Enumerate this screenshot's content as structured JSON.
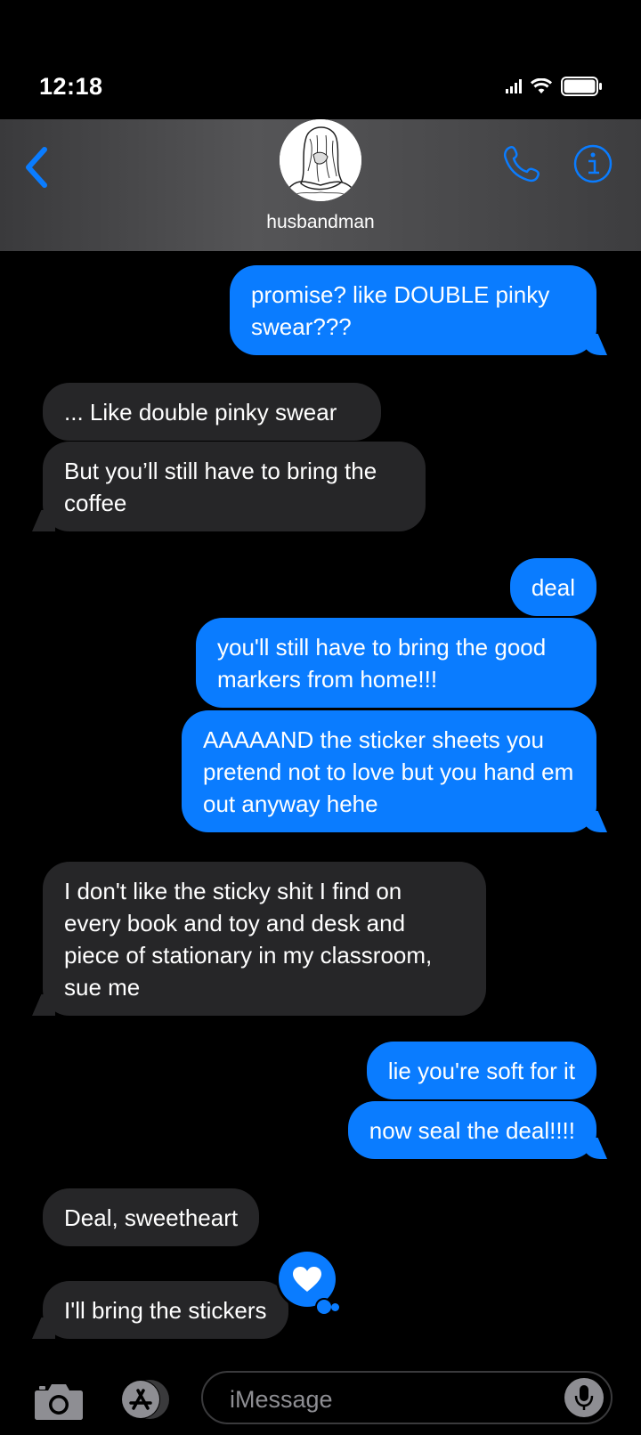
{
  "status_bar": {
    "time": "12:18"
  },
  "header": {
    "contact_name": "husbandman",
    "icons": [
      "chevron-left-icon",
      "phone-icon",
      "info-icon"
    ]
  },
  "colors": {
    "accent": "#0a7cff",
    "received_bubble": "#262628",
    "background": "#000000"
  },
  "messages": [
    {
      "from": "me",
      "text": "promise? like DOUBLE pinky swear???"
    },
    {
      "from": "them",
      "text": "... Like double pinky swear"
    },
    {
      "from": "them",
      "text": "But you’ll still have to bring the coffee"
    },
    {
      "from": "me",
      "text": "deal"
    },
    {
      "from": "me",
      "text": "you'll still have to bring the good markers from home!!!"
    },
    {
      "from": "me",
      "text": "AAAAAND the sticker sheets you pretend not to love but you hand em out anyway hehe"
    },
    {
      "from": "them",
      "text": "I don't like the sticky shit I find on every book and toy and desk and piece of stationary in my classroom, sue me"
    },
    {
      "from": "me",
      "text": "lie you're soft for it"
    },
    {
      "from": "me",
      "text": "now seal the deal!!!!"
    },
    {
      "from": "them",
      "text": "Deal, sweetheart"
    },
    {
      "from": "them",
      "text": "I'll bring the stickers",
      "tapback": "heart-icon"
    }
  ],
  "compose": {
    "placeholder": "iMessage",
    "icons": [
      "camera-icon",
      "app-store-icon",
      "microphone-icon"
    ]
  }
}
